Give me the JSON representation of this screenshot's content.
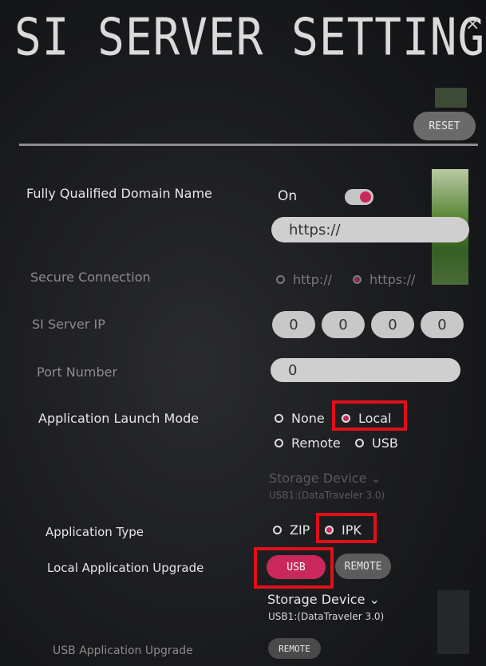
{
  "header": {
    "title": "SI SERVER SETTING",
    "close_glyph": "×",
    "reset_label": "RESET"
  },
  "fqdn": {
    "label": "Fully Qualified Domain Name",
    "state": "On",
    "url_value": "https://"
  },
  "secure_connection": {
    "label": "Secure Connection",
    "options": [
      "http://",
      "https://"
    ],
    "selected": "https://"
  },
  "server_ip": {
    "label": "SI Server IP",
    "octets": [
      "0",
      "0",
      "0",
      "0"
    ]
  },
  "port": {
    "label": "Port Number",
    "value": "0"
  },
  "launch_mode": {
    "label": "Application Launch Mode",
    "options": [
      "None",
      "Local",
      "Remote",
      "USB"
    ],
    "selected": "Local"
  },
  "launch_storage": {
    "title": "Storage Device",
    "device": "USB1:(DataTraveler 3.0)"
  },
  "app_type": {
    "label": "Application Type",
    "options": [
      "ZIP",
      "IPK"
    ],
    "selected": "IPK"
  },
  "local_upgrade": {
    "label": "Local Application Upgrade",
    "usb_label": "USB",
    "remote_label": "REMOTE",
    "selected": "USB"
  },
  "upgrade_storage": {
    "title": "Storage Device",
    "device": "USB1:(DataTraveler 3.0)"
  },
  "usb_upgrade": {
    "label": "USB Application Upgrade",
    "remote_label": "REMOTE"
  },
  "colors": {
    "accent": "#c8285a",
    "highlight": "#e0101a"
  }
}
